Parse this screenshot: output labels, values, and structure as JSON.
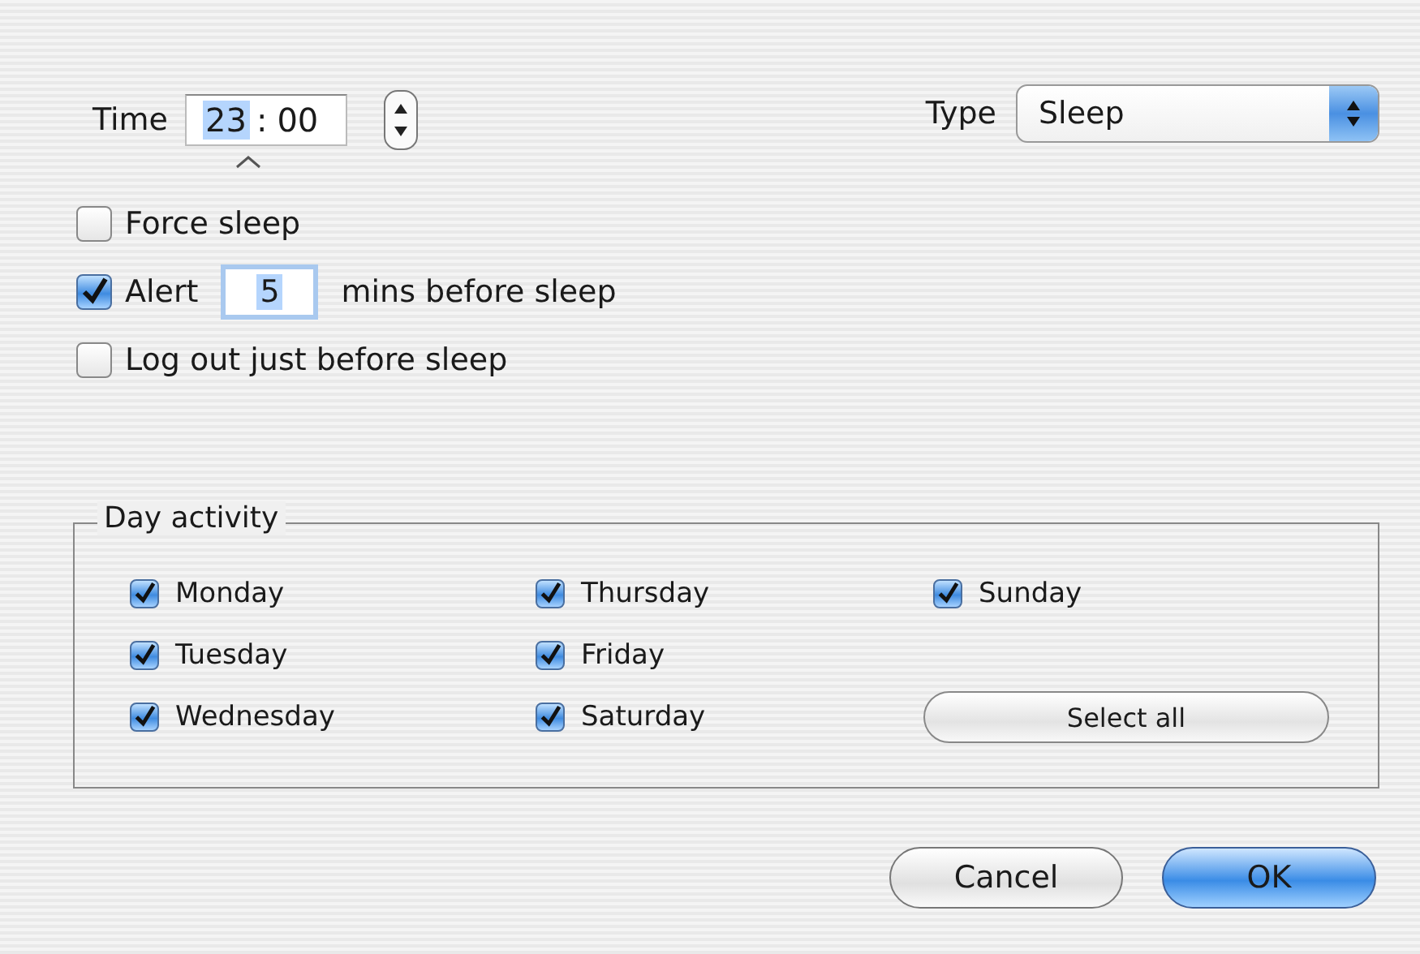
{
  "time": {
    "label": "Time",
    "hours": "23",
    "separator": ":",
    "minutes": "00",
    "hours_selected": true
  },
  "type": {
    "label": "Type",
    "value": "Sleep"
  },
  "options": [
    {
      "kind": "checkbox",
      "label": "Force sleep",
      "checked": false
    },
    {
      "kind": "alert",
      "label": "Alert",
      "checked": true,
      "value": "5",
      "suffix": "mins before sleep"
    },
    {
      "kind": "checkbox",
      "label": "Log out just before sleep",
      "checked": false
    }
  ],
  "day_activity": {
    "title": "Day activity",
    "days": [
      {
        "label": "Monday",
        "checked": true
      },
      {
        "label": "Tuesday",
        "checked": true
      },
      {
        "label": "Wednesday",
        "checked": true
      },
      {
        "label": "Thursday",
        "checked": true
      },
      {
        "label": "Friday",
        "checked": true
      },
      {
        "label": "Saturday",
        "checked": true
      },
      {
        "label": "Sunday",
        "checked": true
      }
    ],
    "select_all": "Select all"
  },
  "buttons": [
    {
      "label": "Cancel",
      "default": false
    },
    {
      "label": "OK",
      "default": true
    }
  ]
}
